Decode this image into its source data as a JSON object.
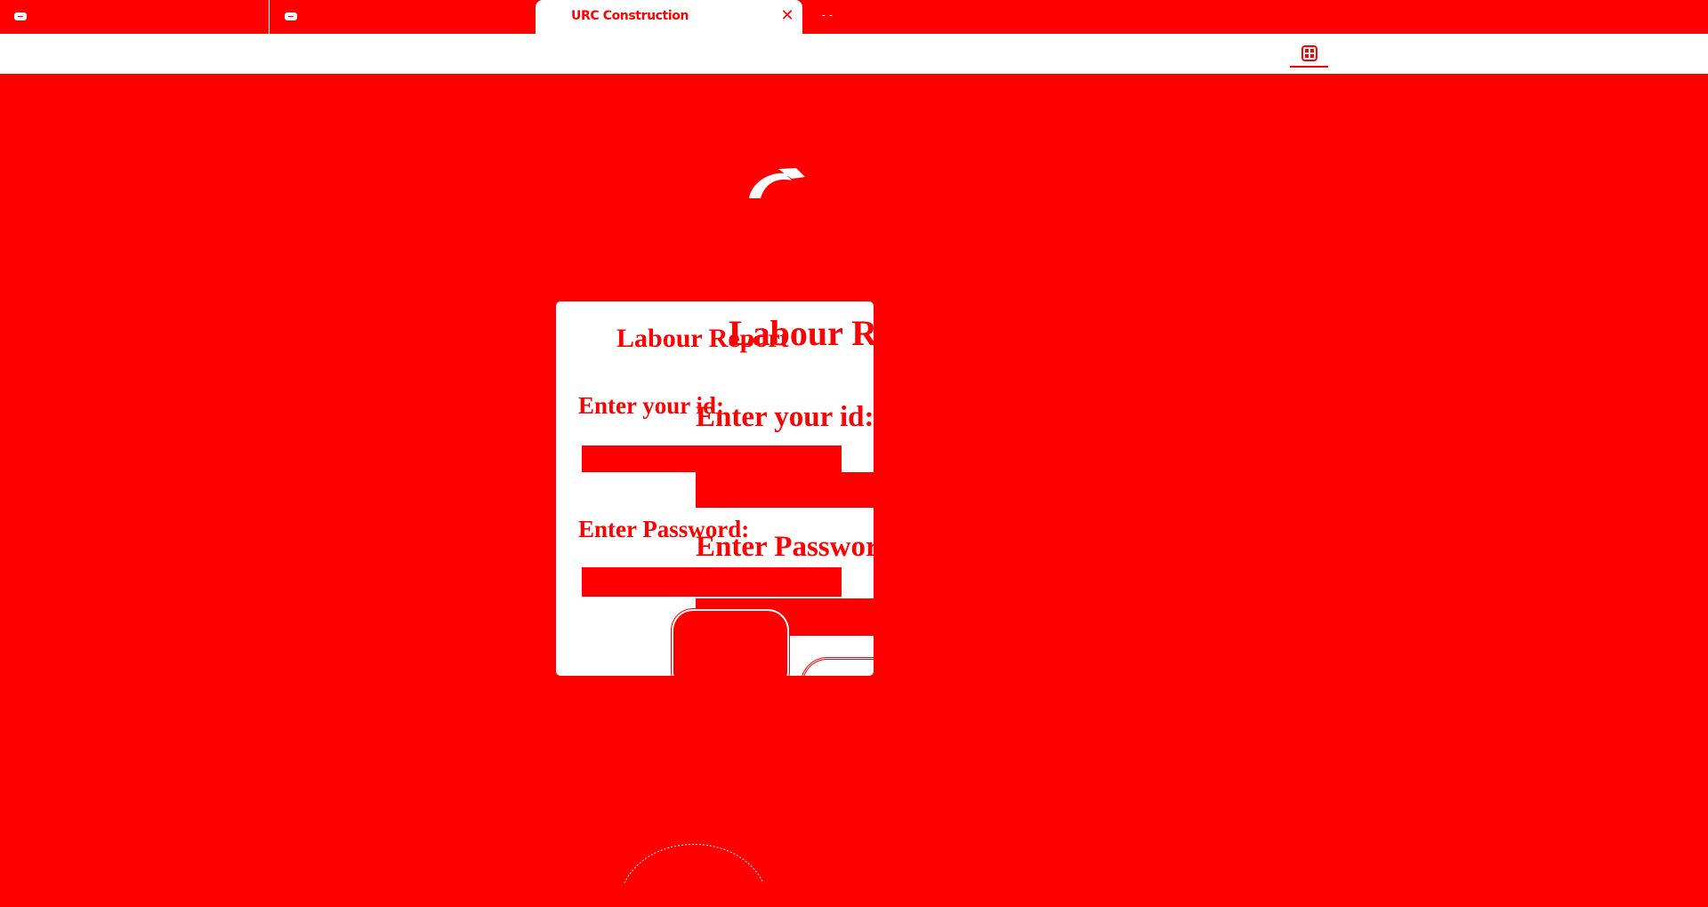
{
  "browser": {
    "tabs": [
      {
        "title": ""
      },
      {
        "title": ""
      },
      {
        "title": "URC Construction",
        "active": true
      }
    ],
    "close_glyph": "✕",
    "new_tab_glyph": "- -",
    "toolbar": {
      "extension_icon": "extension-grid-icon"
    }
  },
  "page": {
    "logo_icon": "arc-logo-icon",
    "form": {
      "title": "Labour Report",
      "id_label": "Enter your id:",
      "id_value": "",
      "password_label": "Enter Password:",
      "password_value": "",
      "submit_label": ""
    },
    "colors": {
      "background": "#ff0000",
      "card": "#ffffff",
      "text": "#ff0000"
    }
  }
}
